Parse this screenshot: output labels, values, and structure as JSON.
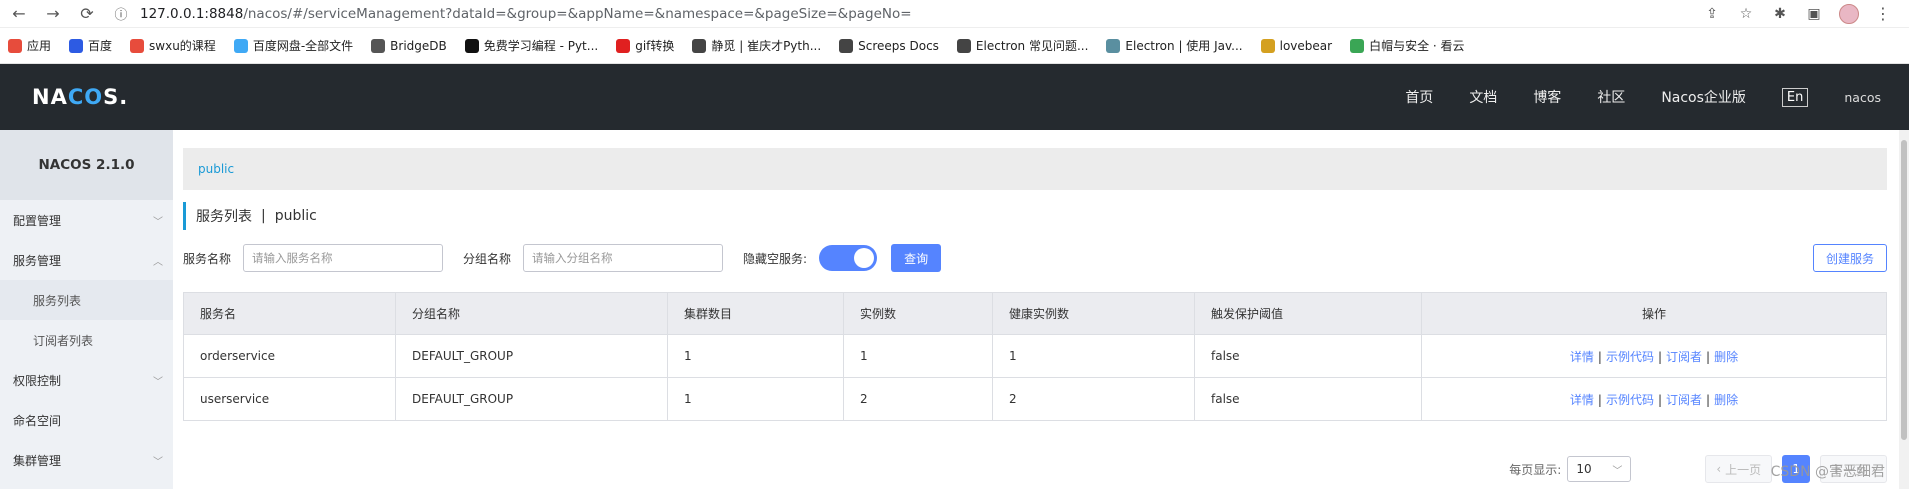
{
  "browser": {
    "url_host": "127.0.0.1:8848",
    "url_path": "/nacos/#/serviceManagement?dataId=&group=&appName=&namespace=&pageSize=&pageNo=",
    "bookmarks": [
      {
        "label": "应用",
        "color": "#e74c3c"
      },
      {
        "label": "百度",
        "color": "#2d5be3"
      },
      {
        "label": "swxu的课程",
        "color": "#e74c3c"
      },
      {
        "label": "百度网盘-全部文件",
        "color": "#3fa9f5"
      },
      {
        "label": "BridgeDB",
        "color": "#555555"
      },
      {
        "label": "免费学习编程 - Pyt...",
        "color": "#111111"
      },
      {
        "label": "gif转换",
        "color": "#e02020"
      },
      {
        "label": "静觅 | 崔庆才Pyth...",
        "color": "#444444"
      },
      {
        "label": "Screeps Docs",
        "color": "#444444"
      },
      {
        "label": "Electron 常见问题...",
        "color": "#444444"
      },
      {
        "label": "Electron | 使用 Jav...",
        "color": "#5a8fa0"
      },
      {
        "label": "lovebear",
        "color": "#d4a020"
      },
      {
        "label": "白帽与安全 · 看云",
        "color": "#3aa655"
      }
    ]
  },
  "header": {
    "logo": "NACOS.",
    "nav": [
      "首页",
      "文档",
      "博客",
      "社区",
      "Nacos企业版"
    ],
    "lang": "En",
    "user": "nacos"
  },
  "sidebar": {
    "title": "NACOS 2.1.0",
    "items": [
      {
        "label": "配置管理",
        "chevron": "down"
      },
      {
        "label": "服务管理",
        "chevron": "up"
      },
      {
        "label": "服务列表",
        "sub": true,
        "active": true
      },
      {
        "label": "订阅者列表",
        "sub": true
      },
      {
        "label": "权限控制",
        "chevron": "down"
      },
      {
        "label": "命名空间"
      },
      {
        "label": "集群管理",
        "chevron": "down"
      }
    ]
  },
  "main": {
    "namespace_tab": "public",
    "title": "服务列表",
    "title_sep": "|",
    "title_ns": "public",
    "filters": {
      "service_label": "服务名称",
      "service_placeholder": "请输入服务名称",
      "group_label": "分组名称",
      "group_placeholder": "请输入分组名称",
      "hide_empty_label": "隐藏空服务:",
      "query_button": "查询",
      "create_button": "创建服务"
    },
    "table": {
      "headers": [
        "服务名",
        "分组名称",
        "集群数目",
        "实例数",
        "健康实例数",
        "触发保护阈值",
        "操作"
      ],
      "rows": [
        [
          "orderservice",
          "DEFAULT_GROUP",
          "1",
          "1",
          "1",
          "false"
        ],
        [
          "userservice",
          "DEFAULT_GROUP",
          "1",
          "2",
          "2",
          "false"
        ]
      ],
      "ops": [
        "详情",
        "示例代码",
        "订阅者",
        "删除"
      ]
    },
    "pager": {
      "per_page_label": "每页显示:",
      "per_page_value": "10",
      "prev": "上一页",
      "current": "1",
      "next": "下一页"
    }
  },
  "watermark": "CSDN @害恶细君",
  "colors": {
    "primary": "#5584ff",
    "header_bg": "#252a2f",
    "link": "#1a9ad6"
  }
}
